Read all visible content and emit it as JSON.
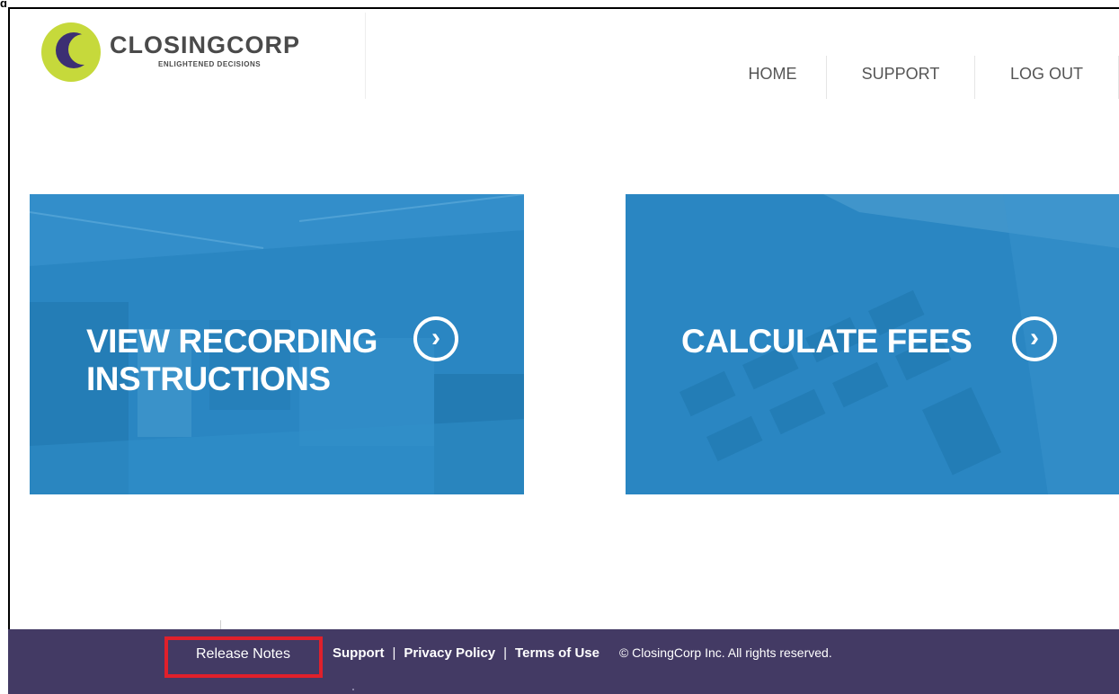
{
  "page_fragment": "g",
  "logo": {
    "name": "CLOSINGCORP",
    "tagline": "ENLIGHTENED DECISIONS",
    "colors": {
      "ring": "#c6d93b",
      "crescent": "#3c2f73"
    }
  },
  "nav": {
    "home": "HOME",
    "support": "SUPPORT",
    "logout": "LOG OUT"
  },
  "tiles": [
    {
      "line1": "VIEW RECORDING",
      "line2": "INSTRUCTIONS",
      "icon": "chevron-right-circle-icon"
    },
    {
      "line1": "CALCULATE FEES",
      "line2": "",
      "icon": "chevron-right-circle-icon"
    }
  ],
  "footer": {
    "release_notes": "Release Notes",
    "support": "Support",
    "privacy": "Privacy Policy",
    "terms": "Terms of Use",
    "copyright": "© ClosingCorp Inc. All rights reserved.",
    "background": "#433a64",
    "highlight": "#e0202b"
  },
  "colors": {
    "tile": "#2a86c2"
  }
}
